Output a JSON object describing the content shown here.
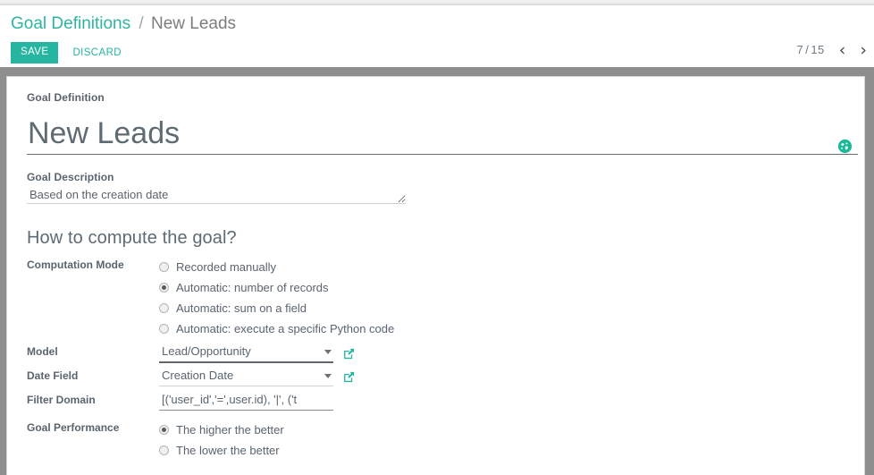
{
  "control_panel": {
    "breadcrumb": {
      "parent": "Goal Definitions",
      "separator": "/",
      "current": "New Leads"
    },
    "save_label": "SAVE",
    "discard_label": "DISCARD",
    "pager": {
      "current": "7",
      "separator": "/",
      "total": "15",
      "prev_icon": "‹",
      "next_icon": "›"
    }
  },
  "form": {
    "goal_definition_label": "Goal Definition",
    "title_value": "New Leads",
    "translate_icon": "globe-icon",
    "description_label": "Goal Description",
    "description_value": "Based on the creation date",
    "section_title": "How to compute the goal?",
    "computation_mode": {
      "label": "Computation Mode",
      "options": [
        {
          "label": "Recorded manually",
          "selected": false
        },
        {
          "label": "Automatic: number of records",
          "selected": true
        },
        {
          "label": "Automatic: sum on a field",
          "selected": false
        },
        {
          "label": "Automatic: execute a specific Python code",
          "selected": false
        }
      ]
    },
    "model": {
      "label": "Model",
      "value": "Lead/Opportunity",
      "external_icon": "external-link-icon"
    },
    "date_field": {
      "label": "Date Field",
      "value": "Creation Date",
      "external_icon": "external-link-icon"
    },
    "filter_domain": {
      "label": "Filter Domain",
      "value": "[('user_id','=',user.id), '|', ('t"
    },
    "goal_performance": {
      "label": "Goal Performance",
      "options": [
        {
          "label": "The higher the better",
          "selected": true
        },
        {
          "label": "The lower the better",
          "selected": false
        }
      ]
    }
  },
  "colors": {
    "accent": "#26b5a0",
    "frame_grey": "#8e8e8e",
    "label_grey": "#5a646e"
  }
}
